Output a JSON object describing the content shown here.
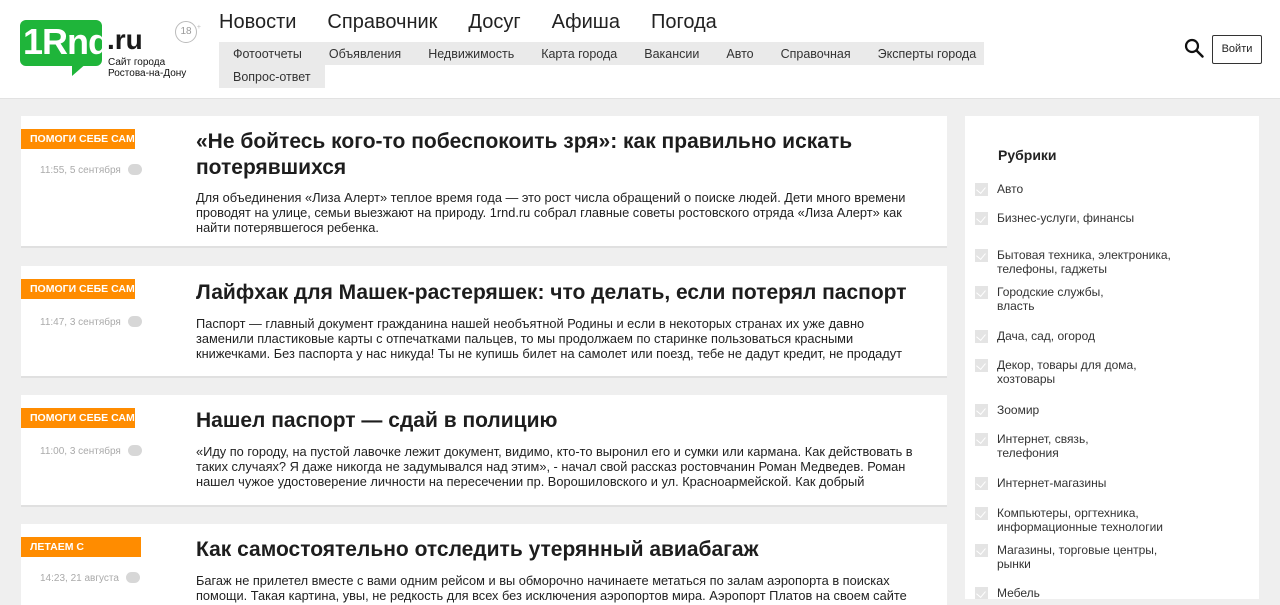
{
  "logo": {
    "number": "1Rnd",
    "domain": ".ru",
    "tagline": "Сайт города Ростова-на-Дону"
  },
  "age_badge": "18",
  "nav": {
    "main": [
      "Новости",
      "Справочник",
      "Досуг",
      "Афиша",
      "Погода"
    ],
    "sub": [
      "Фотоотчеты",
      "Объявления",
      "Недвижимость",
      "Карта города",
      "Вакансии",
      "Авто",
      "Справочная",
      "Эксперты города"
    ],
    "sub2": "Вопрос-ответ"
  },
  "header": {
    "login_label": "Войти"
  },
  "articles": [
    {
      "tag": "ПОМОГИ СЕБЕ САМ",
      "time": "11:55, 5 сентября",
      "title": "«Не бойтесь кого-то побеспокоить зря»: как правильно искать потерявшихся",
      "text": "Для объединения «Лиза Алерт» теплое время года — это рост числа обращений о поиске людей. Дети много времени проводят на улице, семьи выезжают на природу. 1rnd.ru собрал главные советы ростовского отряда «Лиза Алерт» как найти потерявшегося ребенка."
    },
    {
      "tag": "ПОМОГИ СЕБЕ САМ",
      "time": "11:47, 3 сентября",
      "title": "Лайфхак для Машек-растеряшек: что делать, если потерял паспорт",
      "text": "Паспорт — главный документ гражданина нашей необъятной Родины и если в некоторых странах их уже давно заменили пластиковые карты с отпечатками пальцев, то мы продолжаем по старинке пользоваться красными книжечками. Без паспорта у нас никуда! Ты не купишь билет на самолет или поезд, тебе не дадут кредит, не продадут"
    },
    {
      "tag": "ПОМОГИ СЕБЕ САМ",
      "time": "11:00, 3 сентября",
      "title": "Нашел паспорт — сдай в полицию",
      "text": "«Иду по городу, на пустой лавочке лежит документ, видимо, кто-то выронил его и сумки или кармана. Как действовать в таких случаях? Я даже никогда не задумывался над этим», - начал свой рассказ ростовчанин Роман Медведев. Роман нашел чужое удостоверение личности на пересечении пр. Ворошиловского и ул. Красноармейской. Как добрый"
    },
    {
      "tag": "ЛЕТАЕМ С",
      "time": "14:23, 21 августа",
      "title": "Как самостоятельно отследить утерянный авиабагаж",
      "text": "Багаж не прилетел вместе с вами одним рейсом и вы обморочно начинаете метаться по залам аэропорта в поисках помощи. Такая картина, увы, не редкость для всех без исключения аэропортов мира. Аэропорт Платов на своем сайте"
    }
  ],
  "sidebar": {
    "title": "Рубрики",
    "categories": [
      "Авто",
      "Бизнес-услуги, финансы",
      "Бытовая техника, электроника, телефоны, гаджеты",
      "Городские службы, власть",
      "Дача, сад, огород",
      "Декор, товары для дома, хозтовары",
      "Зоомир",
      "Интернет, связь, телефония",
      "Интернет-магазины",
      "Компьютеры, оргтехника, информационные технологии",
      "Магазины, торговые центры, рынки",
      "Мебель"
    ]
  },
  "colors": {
    "accent": "#ff8c00",
    "logo_green": "#1fb53a"
  }
}
